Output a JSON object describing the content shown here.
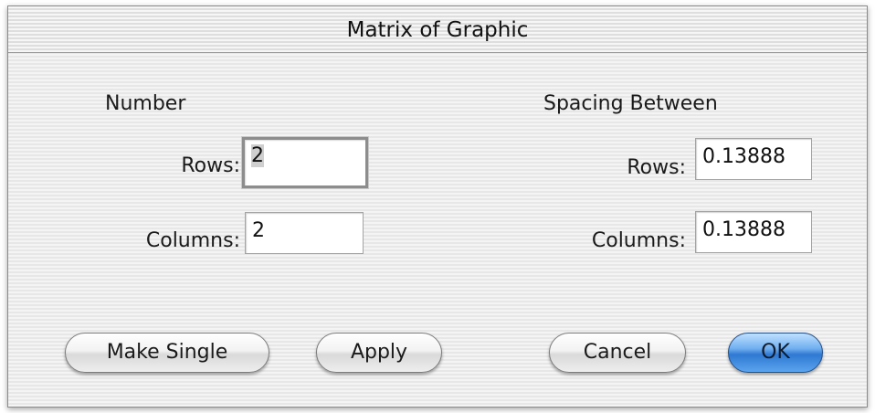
{
  "dialog": {
    "title": "Matrix of Graphic"
  },
  "number": {
    "heading": "Number",
    "rows_label": "Rows:",
    "rows_value": "2",
    "columns_label": "Columns:",
    "columns_value": "2"
  },
  "spacing": {
    "heading": "Spacing Between",
    "rows_label": "Rows:",
    "rows_value": "0.13888",
    "columns_label": "Columns:",
    "columns_value": "0.13888"
  },
  "buttons": {
    "make_single": "Make Single",
    "apply": "Apply",
    "cancel": "Cancel",
    "ok": "OK"
  }
}
